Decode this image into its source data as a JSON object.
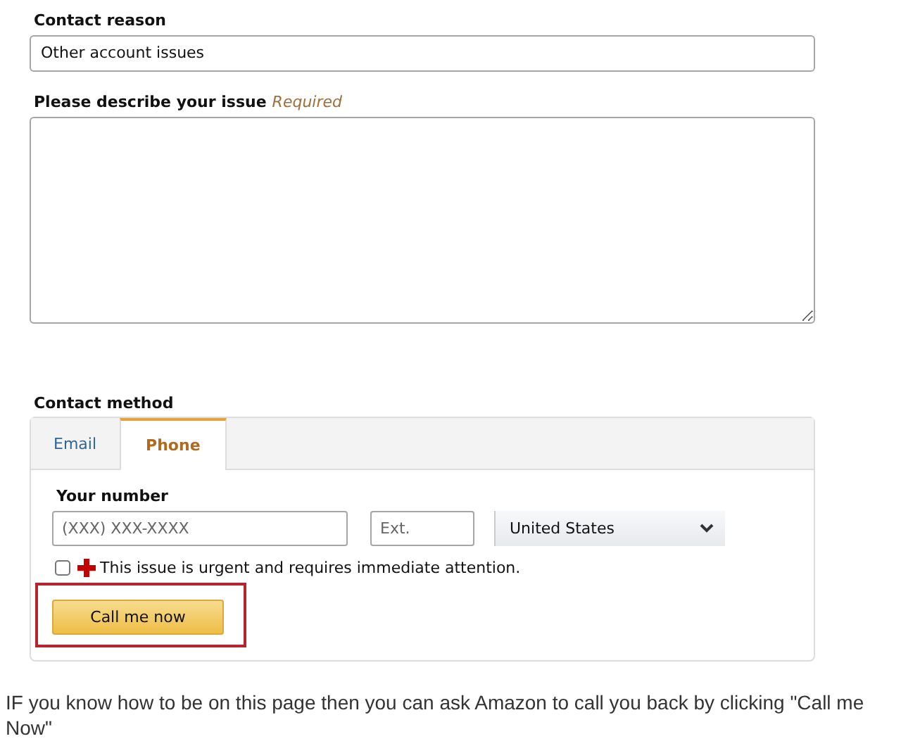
{
  "contact_reason": {
    "label": "Contact reason",
    "value": "Other account issues"
  },
  "issue": {
    "label": "Please describe your issue",
    "required": "Required"
  },
  "contact_method": {
    "label": "Contact method",
    "tabs": [
      {
        "label": "Email",
        "selected": false
      },
      {
        "label": "Phone",
        "selected": true
      }
    ],
    "number_label": "Your number",
    "phone": {
      "placeholder": "(XXX) XXX-XXXX"
    },
    "ext": {
      "placeholder": "Ext."
    },
    "country": "United States",
    "urgent": {
      "label": "This issue is urgent and requires immediate attention.",
      "checked": false
    },
    "button": "Call me now"
  },
  "caption": "IF you know how to be on this page then you can ask Amazon to call you back by clicking \"Call me Now\""
}
